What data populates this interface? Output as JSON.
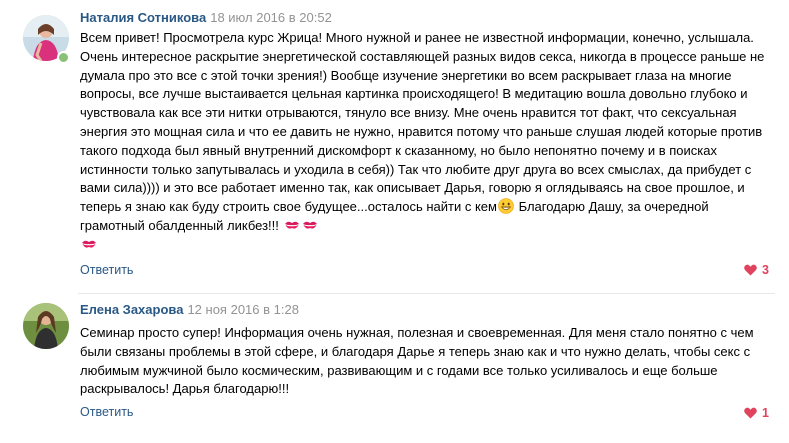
{
  "colors": {
    "author": "#2a5885",
    "date": "#939393",
    "like": "#e0435d",
    "divider": "#e7e8ec",
    "online": "#8ac176"
  },
  "comments": [
    {
      "author": "Наталия Сотникова",
      "date": "18 июл 2016 в 20:52",
      "online": true,
      "text_before_emoji": "Всем привет! Просмотрела курс Жрица! Много нужной и ранее не известной информации, конечно, услышала. Очень интересное раскрытие энергетической составляющей разных видов секса, никогда в процессе раньше не думала про это все с этой точки зрения!) Вообще изучение энергетики во всем раскрывает глаза на многие вопросы, все лучше выстаивается цельная картинка происходящего! В медитацию вошла довольно глубоко и чувствовала как все эти нитки отрываются, тянуло все внизу. Мне очень нравится тот факт, что сексуальная энергия это мощная сила и что ее давить не нужно, нравится потому что раньше слушая людей которые против такого подхода был явный внутренний дискомфорт к сказанному, но было непонятно почему и в поисках истинности только запутывалась и уходила в себя)) Так что любите друг друга во всех смыслах, да прибудет с вами сила)))) и это все работает именно так, как описывает Дарья, говорю я оглядываясь на свое прошлое, и теперь я знаю как буду строить свое будущее...осталось найти с кем",
      "text_after_emoji": " Благодарю Дашу, за очередной грамотный обалденный ликбез!!! ",
      "emojis": [
        "grin-emoji",
        "kiss-mark-emoji"
      ],
      "reply_label": "Ответить",
      "likes": "3"
    },
    {
      "author": "Елена Захарова",
      "date": "12 ноя 2016 в 1:28",
      "online": false,
      "text": "Семинар просто супер! Информация очень нужная, полезная и своевременная. Для меня стало понятно с чем были связаны проблемы в этой сфере, и благодаря Дарье я теперь знаю как и что нужно делать, чтобы секс с любимым мужчиной было космическим, развивающим и с годами все только усиливалось и еще больше раскрывалось! Дарья благодарю!!!",
      "reply_label": "Ответить",
      "likes": "1"
    }
  ]
}
